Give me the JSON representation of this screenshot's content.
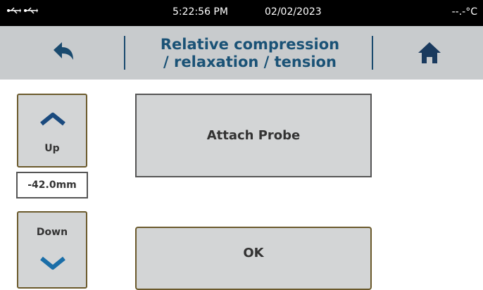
{
  "status": {
    "time": "5:22:56 PM",
    "date": "02/02/2023",
    "temperature": "--.-°C",
    "usb_icons": [
      "usb-icon",
      "usb-icon"
    ]
  },
  "header": {
    "title_line1": "Relative compression",
    "title_line2": "/ relaxation / tension",
    "back_icon": "back-arrow-icon",
    "home_icon": "home-icon",
    "title_color": "#1a5276",
    "background": "#c8cbcd"
  },
  "jog": {
    "up_label": "Up",
    "down_label": "Down",
    "position": "-42.0mm"
  },
  "actions": {
    "attach_label": "Attach Probe",
    "ok_label": "OK"
  }
}
